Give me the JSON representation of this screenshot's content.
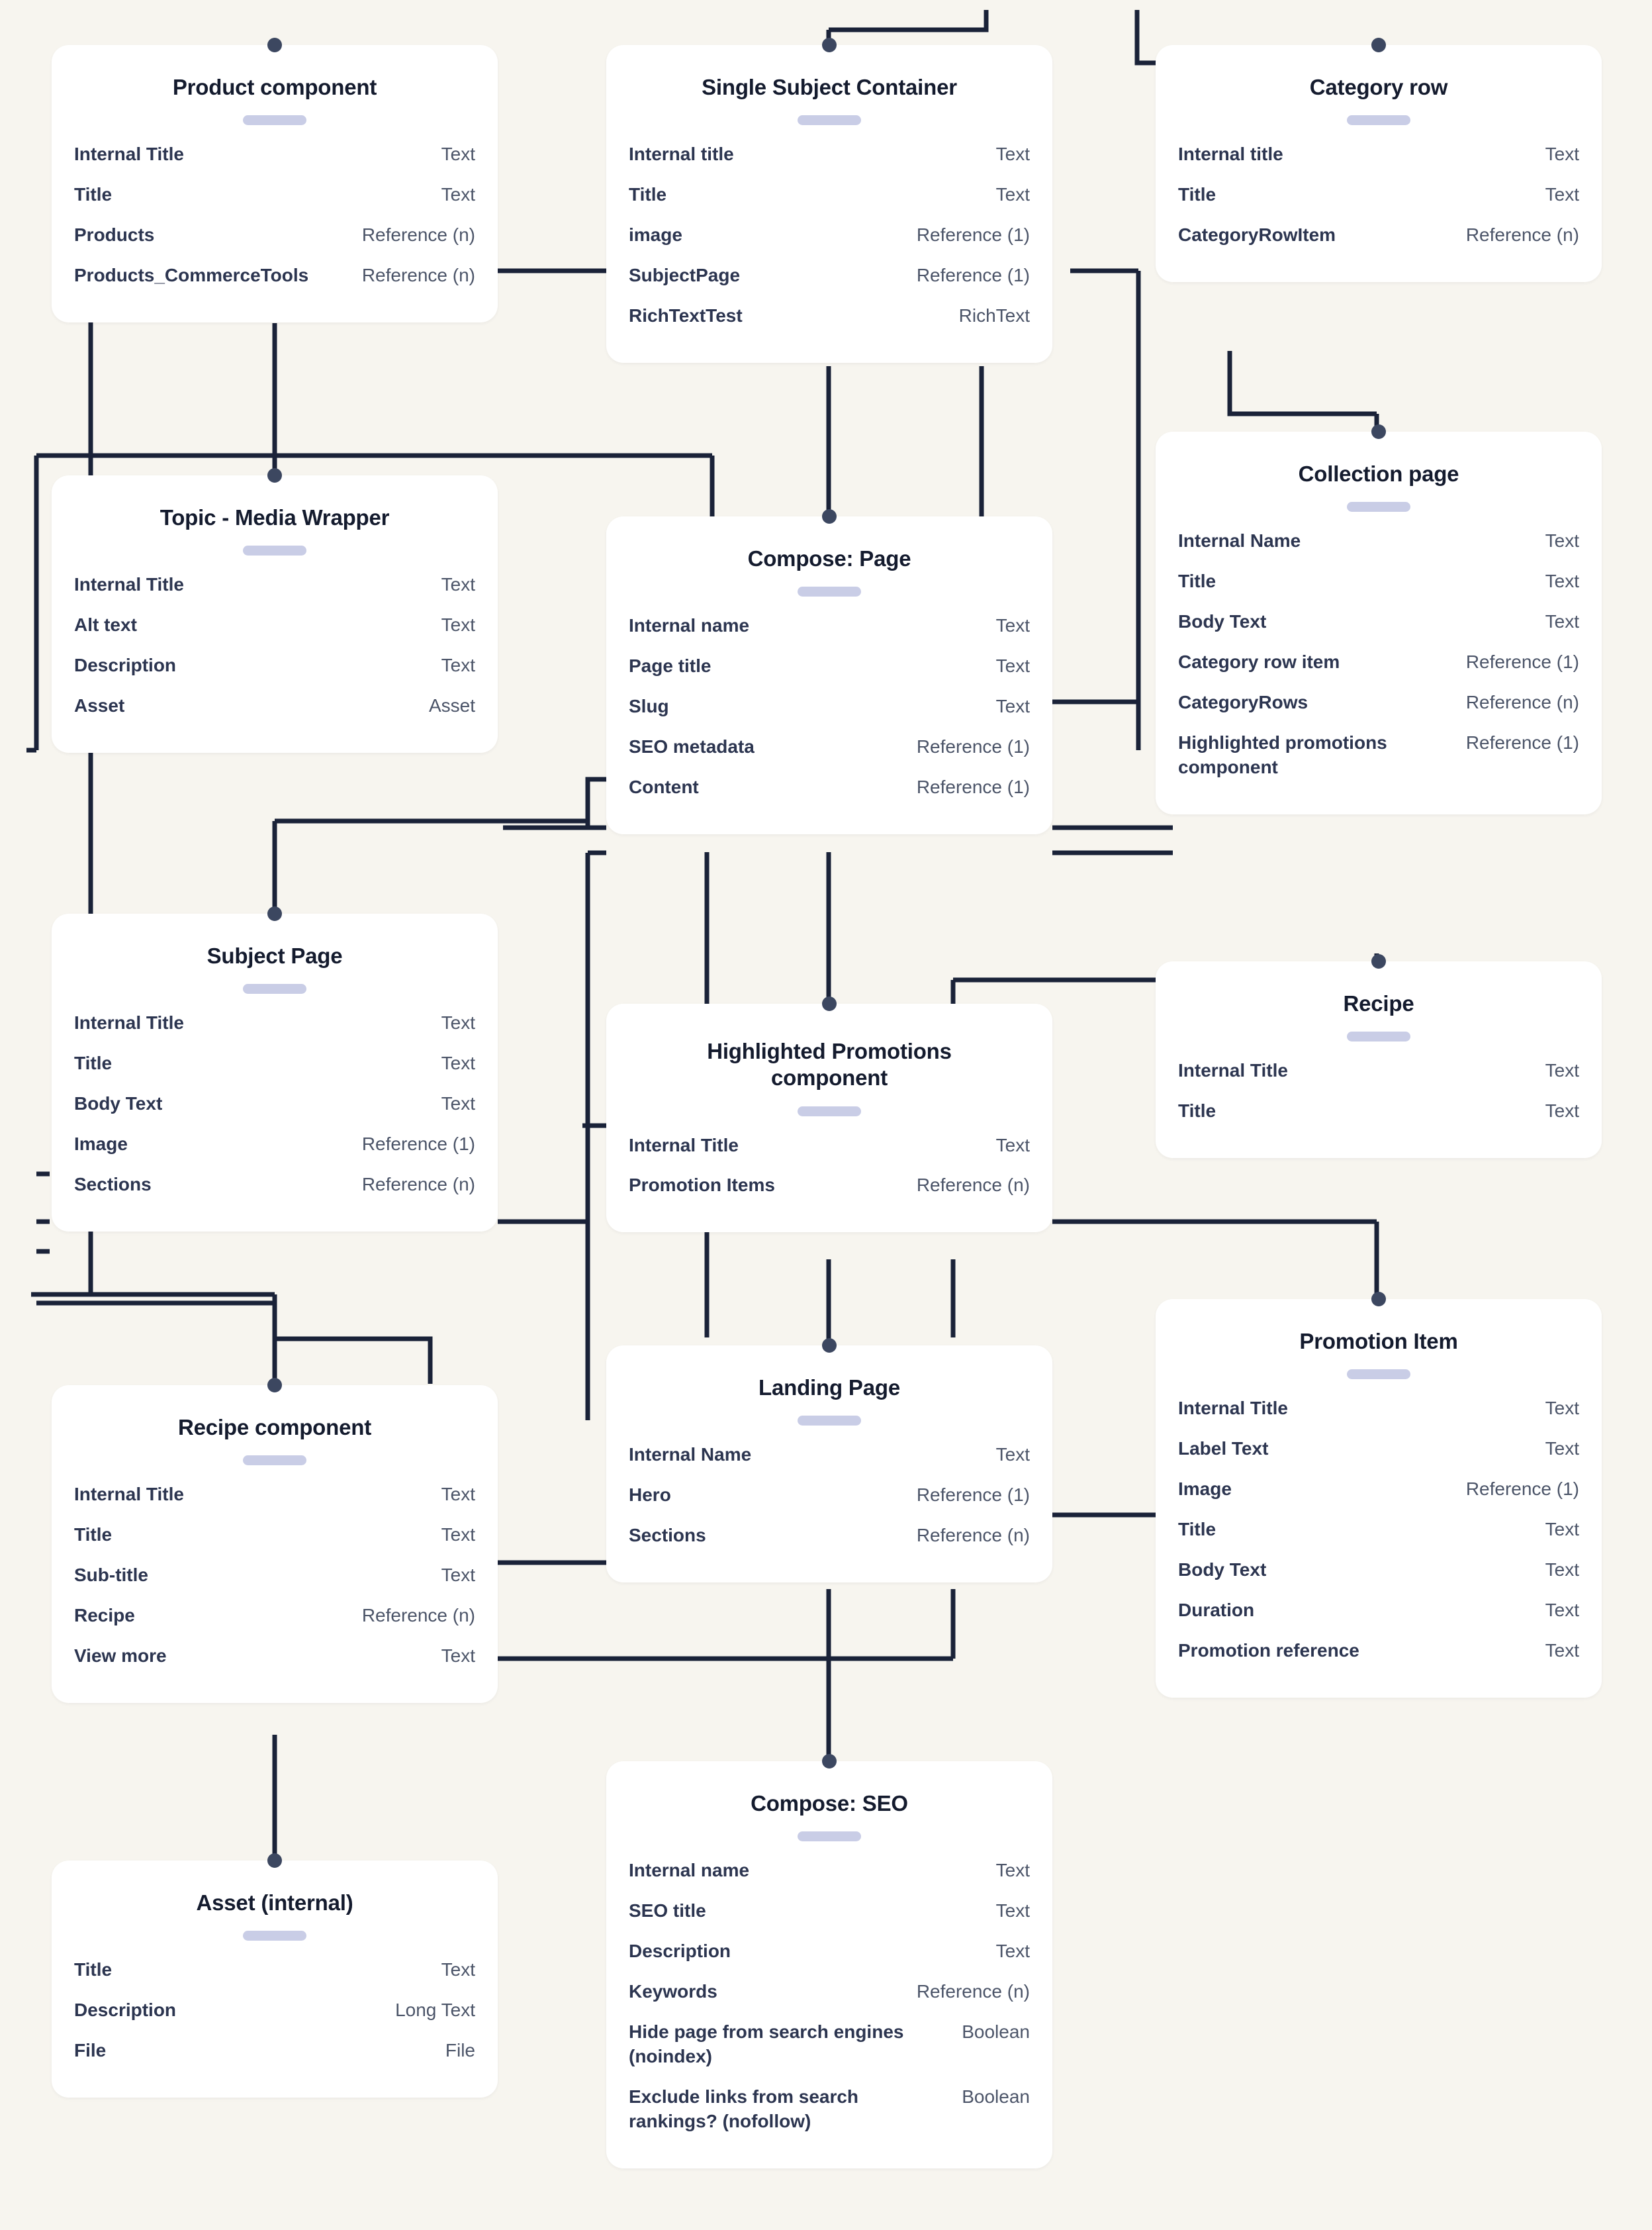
{
  "diagram": {
    "background_color": "#f7f5ef",
    "card_color": "#ffffff",
    "line_color": "#1a2238",
    "anchor_color": "#3c4760",
    "pill_color": "#c9cde6"
  },
  "cards": [
    {
      "id": "product-component",
      "title": "Product component",
      "fields": [
        {
          "name": "Internal Title",
          "type": "Text"
        },
        {
          "name": "Title",
          "type": "Text"
        },
        {
          "name": "Products",
          "type": "Reference (n)"
        },
        {
          "name": "Products_CommerceTools",
          "type": "Reference (n)"
        }
      ]
    },
    {
      "id": "single-subject-container",
      "title": "Single Subject Container",
      "fields": [
        {
          "name": "Internal title",
          "type": "Text"
        },
        {
          "name": "Title",
          "type": "Text"
        },
        {
          "name": "image",
          "type": "Reference (1)"
        },
        {
          "name": "SubjectPage",
          "type": "Reference (1)"
        },
        {
          "name": "RichTextTest",
          "type": "RichText"
        }
      ]
    },
    {
      "id": "category-row",
      "title": "Category row",
      "fields": [
        {
          "name": "Internal title",
          "type": "Text"
        },
        {
          "name": "Title",
          "type": "Text"
        },
        {
          "name": "CategoryRowItem",
          "type": "Reference (n)"
        }
      ]
    },
    {
      "id": "topic-media-wrapper",
      "title": "Topic - Media Wrapper",
      "fields": [
        {
          "name": "Internal Title",
          "type": "Text"
        },
        {
          "name": "Alt text",
          "type": "Text"
        },
        {
          "name": "Description",
          "type": "Text"
        },
        {
          "name": "Asset",
          "type": "Asset"
        }
      ]
    },
    {
      "id": "compose-page",
      "title": "Compose: Page",
      "fields": [
        {
          "name": "Internal name",
          "type": "Text"
        },
        {
          "name": "Page title",
          "type": "Text"
        },
        {
          "name": "Slug",
          "type": "Text"
        },
        {
          "name": "SEO metadata",
          "type": "Reference (1)"
        },
        {
          "name": "Content",
          "type": "Reference (1)"
        }
      ]
    },
    {
      "id": "collection-page",
      "title": "Collection page",
      "fields": [
        {
          "name": "Internal Name",
          "type": "Text"
        },
        {
          "name": "Title",
          "type": "Text"
        },
        {
          "name": "Body Text",
          "type": "Text"
        },
        {
          "name": "Category row item",
          "type": "Reference (1)"
        },
        {
          "name": "CategoryRows",
          "type": "Reference (n)"
        },
        {
          "name": "Highlighted promotions component",
          "type": "Reference (1)"
        }
      ]
    },
    {
      "id": "subject-page",
      "title": "Subject Page",
      "fields": [
        {
          "name": "Internal Title",
          "type": "Text"
        },
        {
          "name": "Title",
          "type": "Text"
        },
        {
          "name": "Body Text",
          "type": "Text"
        },
        {
          "name": "Image",
          "type": "Reference (1)"
        },
        {
          "name": "Sections",
          "type": "Reference (n)"
        }
      ]
    },
    {
      "id": "highlighted-promotions-component",
      "title": "Highlighted Promotions component",
      "fields": [
        {
          "name": "Internal Title",
          "type": "Text"
        },
        {
          "name": "Promotion Items",
          "type": "Reference (n)"
        }
      ]
    },
    {
      "id": "recipe",
      "title": "Recipe",
      "fields": [
        {
          "name": "Internal Title",
          "type": "Text"
        },
        {
          "name": "Title",
          "type": "Text"
        }
      ]
    },
    {
      "id": "recipe-component",
      "title": "Recipe component",
      "fields": [
        {
          "name": "Internal Title",
          "type": "Text"
        },
        {
          "name": "Title",
          "type": "Text"
        },
        {
          "name": "Sub-title",
          "type": "Text"
        },
        {
          "name": "Recipe",
          "type": "Reference (n)"
        },
        {
          "name": "View more",
          "type": "Text"
        }
      ]
    },
    {
      "id": "landing-page",
      "title": "Landing Page",
      "fields": [
        {
          "name": "Internal Name",
          "type": "Text"
        },
        {
          "name": "Hero",
          "type": "Reference (1)"
        },
        {
          "name": "Sections",
          "type": "Reference (n)"
        }
      ]
    },
    {
      "id": "promotion-item",
      "title": "Promotion Item",
      "fields": [
        {
          "name": "Internal Title",
          "type": "Text"
        },
        {
          "name": "Label Text",
          "type": "Text"
        },
        {
          "name": "Image",
          "type": "Reference (1)"
        },
        {
          "name": "Title",
          "type": "Text"
        },
        {
          "name": "Body Text",
          "type": "Text"
        },
        {
          "name": "Duration",
          "type": "Text"
        },
        {
          "name": "Promotion reference",
          "type": "Text"
        }
      ]
    },
    {
      "id": "asset-internal",
      "title": "Asset (internal)",
      "fields": [
        {
          "name": "Title",
          "type": "Text"
        },
        {
          "name": "Description",
          "type": "Long Text"
        },
        {
          "name": "File",
          "type": "File"
        }
      ]
    },
    {
      "id": "compose-seo",
      "title": "Compose: SEO",
      "fields": [
        {
          "name": "Internal name",
          "type": "Text"
        },
        {
          "name": "SEO title",
          "type": "Text"
        },
        {
          "name": "Description",
          "type": "Text"
        },
        {
          "name": "Keywords",
          "type": "Reference (n)"
        },
        {
          "name": "Hide page from search engines (noindex)",
          "type": "Boolean"
        },
        {
          "name": "Exclude links from search rankings? (nofollow)",
          "type": "Boolean"
        }
      ]
    }
  ]
}
